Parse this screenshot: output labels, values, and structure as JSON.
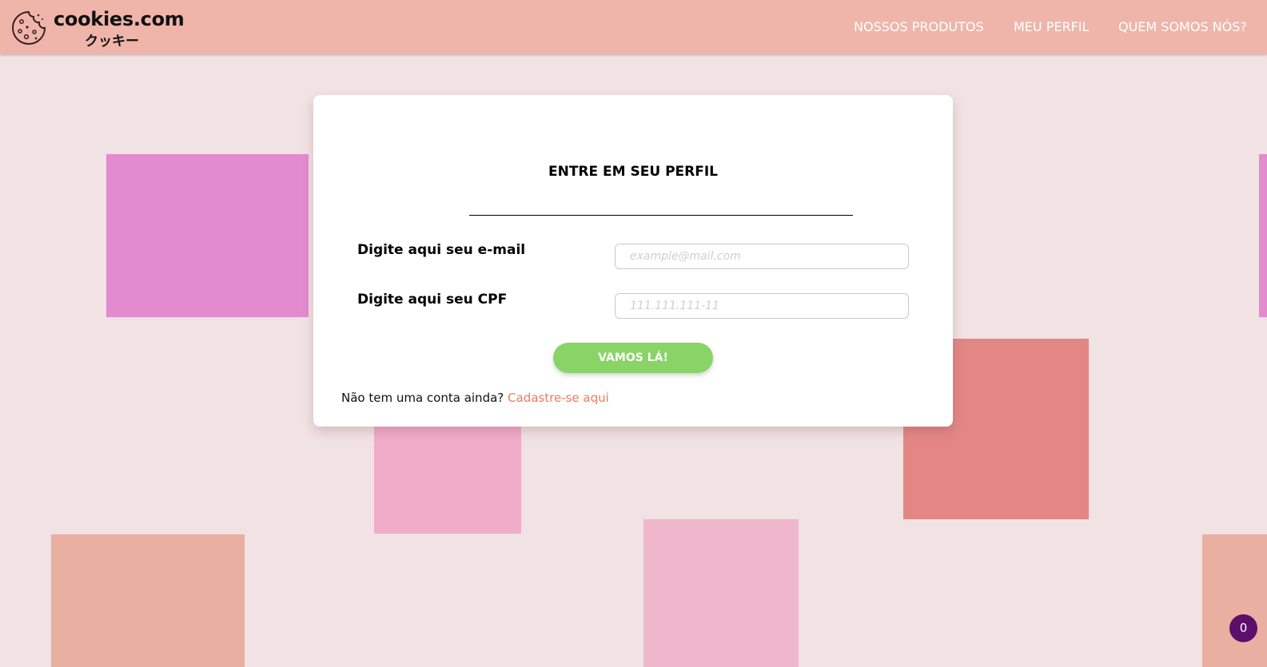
{
  "header": {
    "brand": "cookies.com",
    "brand_sub": "クッキー",
    "logo_icon": "cookie-icon",
    "nav": [
      {
        "label": "NOSSOS PRODUTOS"
      },
      {
        "label": "MEU PERFIL"
      },
      {
        "label": "QUEM SOMOS NÓS?"
      }
    ]
  },
  "login": {
    "title": "ENTRE EM SEU PERFIL",
    "email_label": "Digite aqui seu e-mail",
    "email_placeholder": "example@mail.com",
    "cpf_label": "Digite aqui seu CPF",
    "cpf_placeholder": "111.111.111-11",
    "submit_label": "VAMOS LÁ!",
    "signup_prompt": "Não tem uma conta ainda?",
    "signup_link": "Cadastre-se aqui"
  },
  "cart": {
    "count": "0"
  },
  "colors": {
    "header_bg": "#efb5aa",
    "page_bg": "#f1e2e3",
    "button_bg": "#88d466",
    "link": "#ef7a5c",
    "badge_bg": "#5c0e6b"
  }
}
